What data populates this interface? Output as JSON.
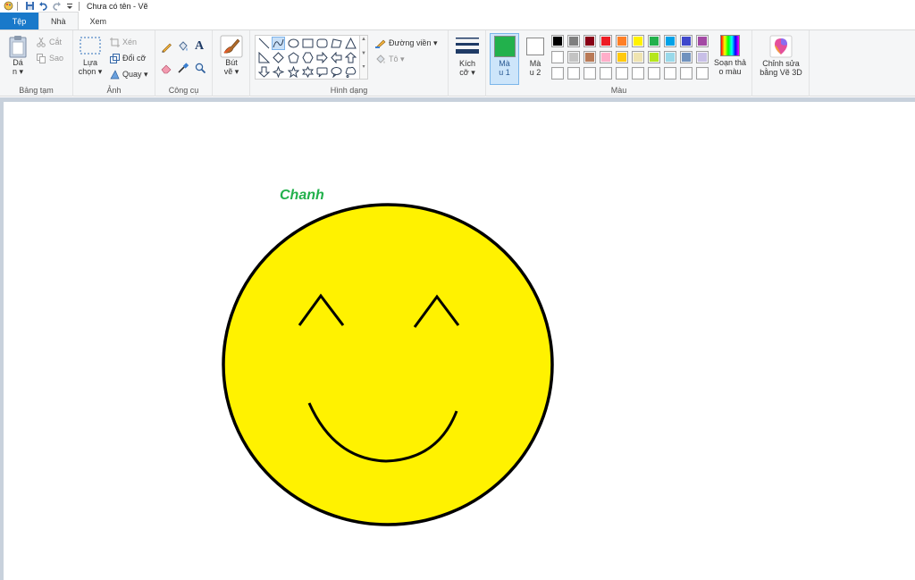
{
  "window": {
    "title": "Chưa có tên - Vẽ"
  },
  "tabs": [
    {
      "label": "Tệp"
    },
    {
      "label": "Nhà"
    },
    {
      "label": "Xem"
    }
  ],
  "clipboard": {
    "paste_line1": "Dá",
    "paste_line2": "n",
    "cut": "Cắt",
    "copy": "Sao",
    "label": "Bảng tạm"
  },
  "image": {
    "select_line1": "Lựa",
    "select_line2": "chọn",
    "crop": "Xén",
    "resize": "Đổi cỡ",
    "rotate": "Quay",
    "label": "Ảnh"
  },
  "tools": {
    "label": "Công cụ"
  },
  "brushes": {
    "line1": "Bút",
    "line2": "vẽ"
  },
  "shapes": {
    "outline": "Đường viền",
    "fill": "Tô",
    "label": "Hình dạng"
  },
  "size": {
    "line1": "Kích",
    "line2": "cỡ"
  },
  "colors": {
    "color1_line1": "Mà",
    "color1_line2": "u 1",
    "color1_value": "#22b14c",
    "color2_line1": "Mà",
    "color2_line2": "u 2",
    "color2_value": "#ffffff",
    "edit_line1": "Soạn thả",
    "edit_line2": "o màu",
    "label": "Màu",
    "row1": [
      "#000000",
      "#7f7f7f",
      "#880015",
      "#ed1c24",
      "#ff7f27",
      "#fff200",
      "#22b14c",
      "#00a2e8",
      "#3f48cc",
      "#a349a4"
    ],
    "row2": [
      "#ffffff",
      "#c3c3c3",
      "#b97a57",
      "#ffaec9",
      "#ffc90e",
      "#efe4b0",
      "#b5e61d",
      "#99d9ea",
      "#7092be",
      "#c8bfe7"
    ],
    "row3": [
      "#ffffff",
      "#ffffff",
      "#ffffff",
      "#ffffff",
      "#ffffff",
      "#ffffff",
      "#ffffff",
      "#ffffff",
      "#ffffff",
      "#ffffff"
    ]
  },
  "paint3d": {
    "line1": "Chỉnh sửa",
    "line2": "bằng Vẽ 3D"
  },
  "canvas": {
    "caption": "Chanh",
    "caption_color": "#22b14c",
    "face_color": "#fff200",
    "stroke_color": "#000000"
  }
}
